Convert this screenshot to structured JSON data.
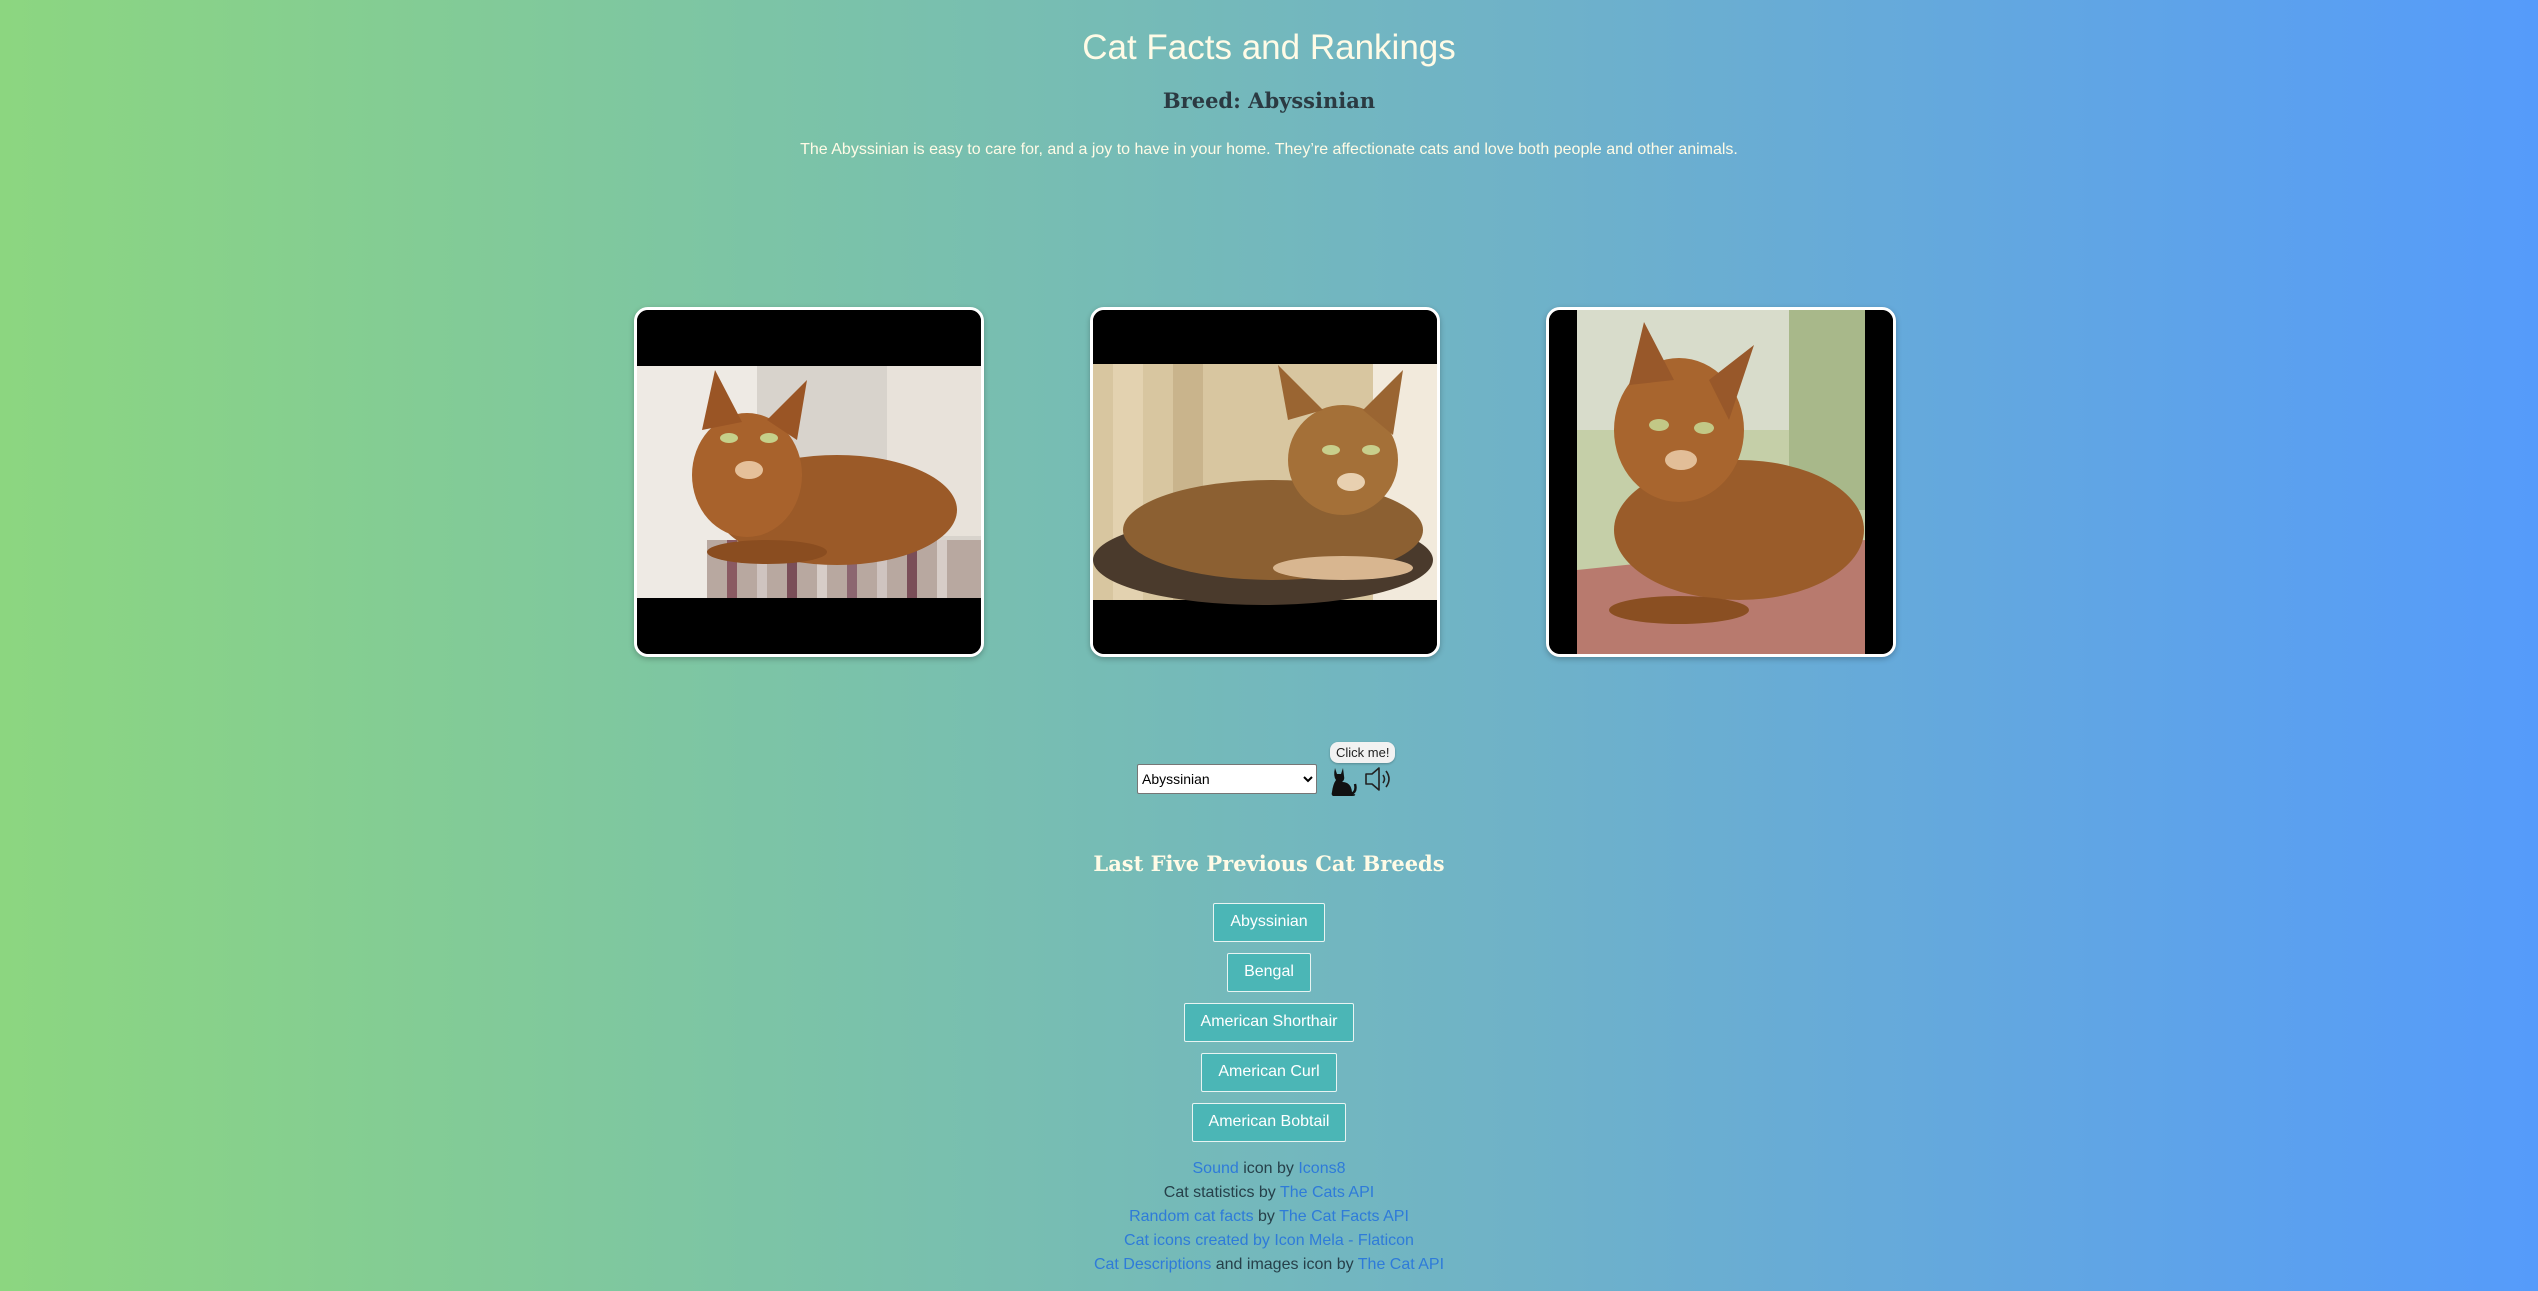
{
  "header": {
    "title": "Cat Facts and Rankings",
    "breed_heading": "Breed: Abyssinian",
    "description": "The Abyssinian is easy to care for, and a joy to have in your home. They’re affectionate cats and love both people and other animals."
  },
  "controls": {
    "selected_breed": "Abyssinian",
    "tooltip": "Click me!"
  },
  "previous": {
    "heading": "Last Five Previous Cat Breeds",
    "breeds": [
      "Abyssinian",
      "Bengal",
      "American Shorthair",
      "American Curl",
      "American Bobtail"
    ]
  },
  "credits": {
    "line1": {
      "link1": "Sound",
      "text1": " icon by ",
      "link2": "Icons8"
    },
    "line2": {
      "text1": "Cat statistics by ",
      "link1": "The Cats API"
    },
    "line3": {
      "link1": "Random cat facts",
      "text1": " by ",
      "link2": "The Cat Facts API"
    },
    "line4": {
      "link1": "Cat icons created by Icon Mela - Flaticon"
    },
    "line5": {
      "link1": "Cat Descriptions",
      "text1": " and images icon by ",
      "link2": "The Cat API"
    }
  },
  "icons": {
    "cat": "cat-icon",
    "sound": "speaker-icon"
  },
  "colors": {
    "gradient_start": "#8cd680",
    "gradient_end": "#559bfb",
    "button_bg": "#4bb6b6",
    "link": "#2e7bd9"
  }
}
